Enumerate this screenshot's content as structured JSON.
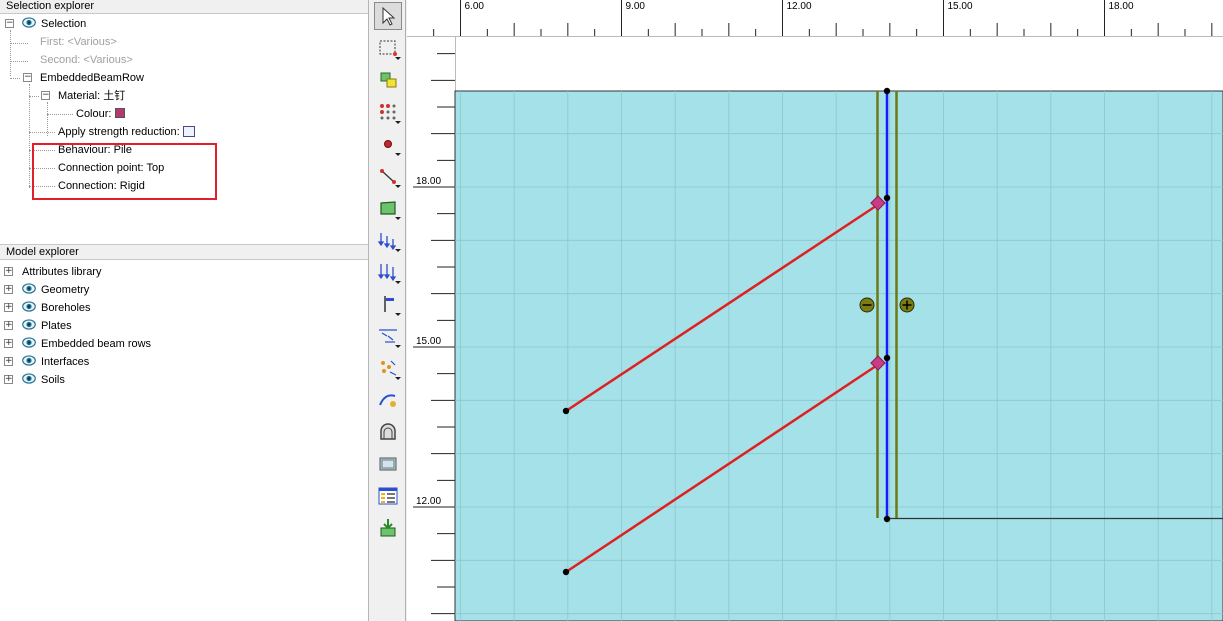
{
  "selection_explorer": {
    "title": "Selection explorer",
    "root": "Selection",
    "first": "First: <Various>",
    "second": "Second: <Various>",
    "object": "EmbeddedBeamRow",
    "material": "Material: 土钉",
    "colour": "Colour:",
    "colour_value": "#b4396e",
    "apply_strength": "Apply strength reduction:",
    "behaviour": "Behaviour: Pile",
    "connection_point": "Connection point: Top",
    "connection": "Connection: Rigid"
  },
  "model_explorer": {
    "title": "Model explorer",
    "items": [
      {
        "label": "Attributes library",
        "has_eye": false
      },
      {
        "label": "Geometry",
        "has_eye": true
      },
      {
        "label": "Boreholes",
        "has_eye": true
      },
      {
        "label": "Plates",
        "has_eye": true
      },
      {
        "label": "Embedded beam rows",
        "has_eye": true
      },
      {
        "label": "Interfaces",
        "has_eye": true
      },
      {
        "label": "Soils",
        "has_eye": true
      }
    ]
  },
  "toolbar": {
    "tools": [
      "select-icon",
      "select-rectangle-icon",
      "move-icon",
      "point-array-icon",
      "create-point-icon",
      "create-line-icon",
      "create-polygon-icon",
      "distributed-load-icon",
      "line-load-icon",
      "prescribed-displacement-icon",
      "water-level-icon",
      "drain-icon",
      "flow-function-icon",
      "tunnel-icon",
      "borehole-image-icon",
      "table-icon",
      "import-icon"
    ]
  },
  "rulers": {
    "x_ticks": [
      "6.00",
      "9.00",
      "12.00",
      "15.00",
      "18.00"
    ],
    "y_ticks": [
      "18.00",
      "15.00",
      "12.00"
    ]
  },
  "colors": {
    "soil": "#a5e1e8",
    "anchor": "#e02020",
    "beam": "#1a1aff",
    "plate": "#6b7a12",
    "highlight": "#e0202a"
  }
}
